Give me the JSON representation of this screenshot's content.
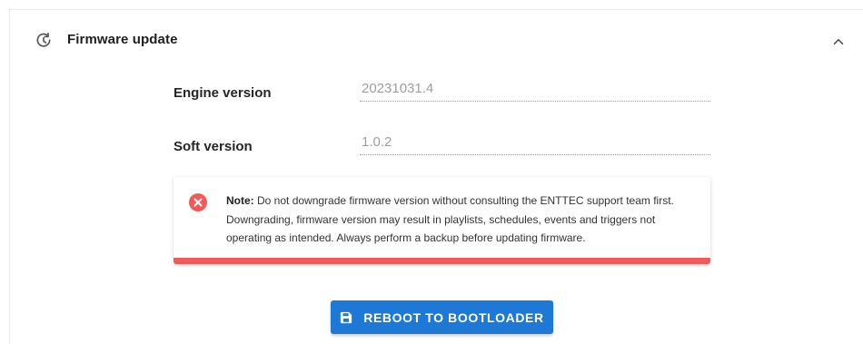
{
  "section": {
    "title": "Firmware update",
    "icon": "refresh-clock-icon",
    "collapse_icon": "chevron-up-icon"
  },
  "fields": [
    {
      "label": "Engine version",
      "value": "20231031.4"
    },
    {
      "label": "Soft version",
      "value": "1.0.2"
    }
  ],
  "alert": {
    "icon": "error-circle-icon",
    "prefix": "Note:",
    "message": " Do not downgrade firmware version without consulting the ENTTEC support team first. Downgrading, firmware version may result in playlists, schedules, events and triggers not operating as intended. Always perform a backup before updating firmware.",
    "accent_color": "#f25a5a"
  },
  "action": {
    "label": "REBOOT TO BOOTLOADER",
    "icon": "save-icon",
    "color": "#1e78d6"
  }
}
